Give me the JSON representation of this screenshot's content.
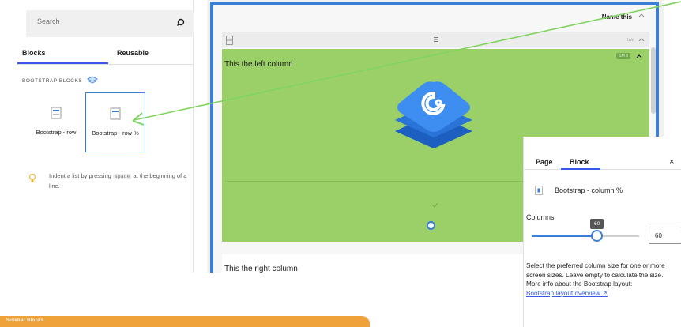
{
  "left_panel": {
    "search_placeholder": "Search",
    "tabs": [
      {
        "label": "Blocks"
      },
      {
        "label": "Reusable"
      }
    ],
    "category": "BOOTSTRAP BLOCKS",
    "blocks": [
      {
        "label": "Bootstrap - row"
      },
      {
        "label": "Bootstrap - row %"
      }
    ],
    "tip": {
      "pre": "Indent a list by pressing",
      "key": "space",
      "post": "at the beginning of a line."
    }
  },
  "editor": {
    "group_name": "Name this",
    "row_label": "row",
    "badge": "SM 8",
    "left_column_text": "This the left column",
    "right_column_text": "This the right column"
  },
  "settings": {
    "tabs": [
      {
        "label": "Page"
      },
      {
        "label": "Block"
      }
    ],
    "close": "×",
    "block_name": "Bootstrap - column %",
    "columns_label": "Columns",
    "columns_value": "60",
    "columns_value_fraction": 0.6,
    "tooltip": "60",
    "description": "Select the preferred column size for one or more screen sizes. Leave empty to calculate the size.",
    "more_info": "More info about the Bootstrap layout:",
    "link": "Bootstrap layout overview"
  },
  "bottom_bar": {
    "label": "Sidebar Blocks"
  },
  "colors": {
    "accent": "#3a7fd5",
    "green": "#9bd069",
    "orange": "#f0a23a",
    "arrow": "#7fd45e"
  }
}
